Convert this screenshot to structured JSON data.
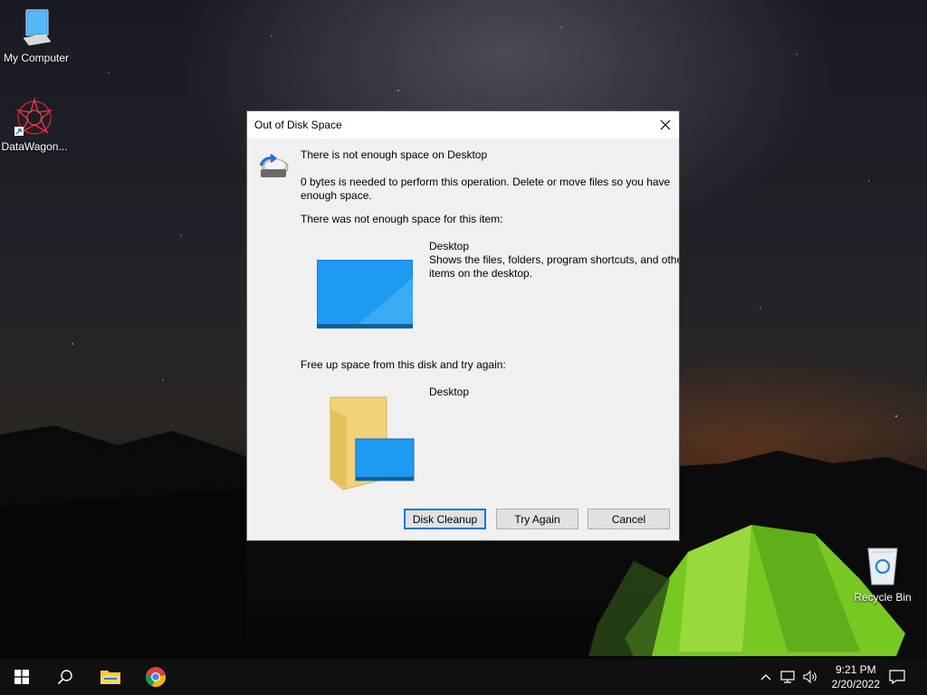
{
  "desktop": {
    "icons": [
      {
        "label": "My Computer"
      },
      {
        "label": "DataWagon..."
      },
      {
        "label": "Recycle Bin"
      }
    ]
  },
  "dialog": {
    "title": "Out of Disk Space",
    "heading": "There is not enough space on Desktop",
    "message_line1": "0 bytes is needed to perform this operation. Delete or move files so you have",
    "message_line2": "enough space.",
    "item_label": "There was not enough space for this item:",
    "item_name": "Desktop",
    "item_desc_line1": "Shows the files, folders, program shortcuts, and other",
    "item_desc_line2": "items on the desktop.",
    "free_label": "Free up space from this disk and try again:",
    "disk_name": "Desktop",
    "buttons": {
      "disk_cleanup": "Disk Cleanup",
      "try_again": "Try Again",
      "cancel": "Cancel"
    }
  },
  "taskbar": {
    "time": "9:21 PM",
    "date": "2/20/2022"
  },
  "colors": {
    "accent": "#0078d7",
    "tent": "#7acc2a",
    "desktop_preview": "#1e9bf0"
  }
}
